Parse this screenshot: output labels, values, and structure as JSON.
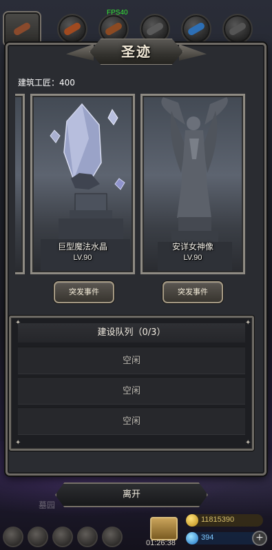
{
  "hud": {
    "fps": "FPS40"
  },
  "top_tabs": [
    {
      "name": "tab-building",
      "color": "#8a4a2c"
    },
    {
      "name": "tab-hero",
      "color": "#a04a20"
    },
    {
      "name": "tab-weapon",
      "color": "#8c4a22"
    },
    {
      "name": "tab-armor",
      "color": "#5a5a5a"
    },
    {
      "name": "tab-magic",
      "color": "#2d6fb5"
    },
    {
      "name": "tab-other",
      "color": "#555555"
    }
  ],
  "panel": {
    "title": "圣迹",
    "craftsman_label": "建筑工匠：400"
  },
  "cards": [
    {
      "name": "巨型魔法水晶",
      "level": "LV.90",
      "event_label": "突发事件"
    },
    {
      "name": "安详女神像",
      "level": "LV.90",
      "event_label": "突发事件"
    }
  ],
  "queue": {
    "title": "建设队列（0/3）",
    "slots": [
      "空闲",
      "空闲",
      "空闲"
    ]
  },
  "leave_label": "离开",
  "bottom": {
    "partial_label": "墓园",
    "timer": "01:26:38",
    "gold": "11815390",
    "gems": "394",
    "plus": "+"
  },
  "colors": {
    "fps": "#38e838",
    "gold": "#d8c06b",
    "gem": "#7ec8ff",
    "frame": "#6f6b65"
  }
}
